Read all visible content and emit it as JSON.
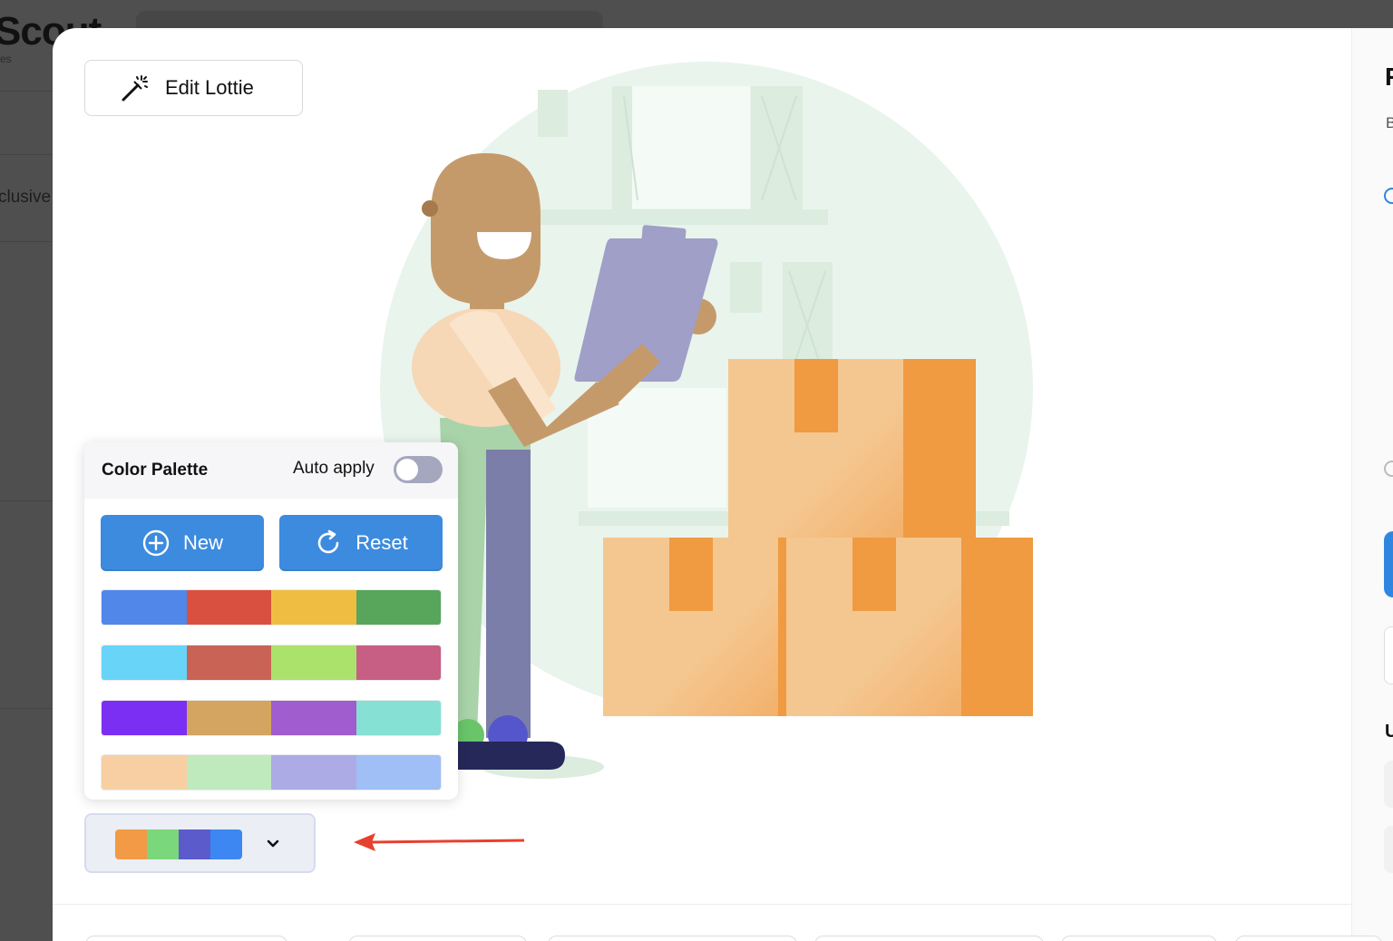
{
  "background": {
    "brand": "Scout",
    "brand_sub": "es",
    "side_text": "clusive"
  },
  "toolbar": {
    "edit_lottie_label": "Edit Lottie"
  },
  "right_panel": {
    "title_initial": "F",
    "subtitle_initial": "B",
    "section_initial": "U"
  },
  "palette": {
    "title": "Color Palette",
    "auto_apply_label": "Auto apply",
    "auto_apply_on": false,
    "new_label": "New",
    "reset_label": "Reset",
    "rows": [
      [
        "#5187e8",
        "#d95040",
        "#f0bd43",
        "#57a65b"
      ],
      [
        "#68d4f8",
        "#c96356",
        "#abe26c",
        "#c75e84"
      ],
      [
        "#7b2ff2",
        "#d3a560",
        "#a05dcd",
        "#86e0d3"
      ],
      [
        "#f8cfa3",
        "#bfeabd",
        "#acabe6",
        "#9fbff6"
      ]
    ],
    "selected": [
      "#f29a45",
      "#7bd77c",
      "#5b5bcc",
      "#3d87f3"
    ]
  },
  "colors": {
    "accent": "#3d8bde",
    "arrow": "#e8402e",
    "box_light": "#f4c791",
    "box_dark": "#f09a42",
    "clipboard": "#9f9fc8",
    "skin": "#c59a6b",
    "circle_bg": "#e9f4ec"
  }
}
